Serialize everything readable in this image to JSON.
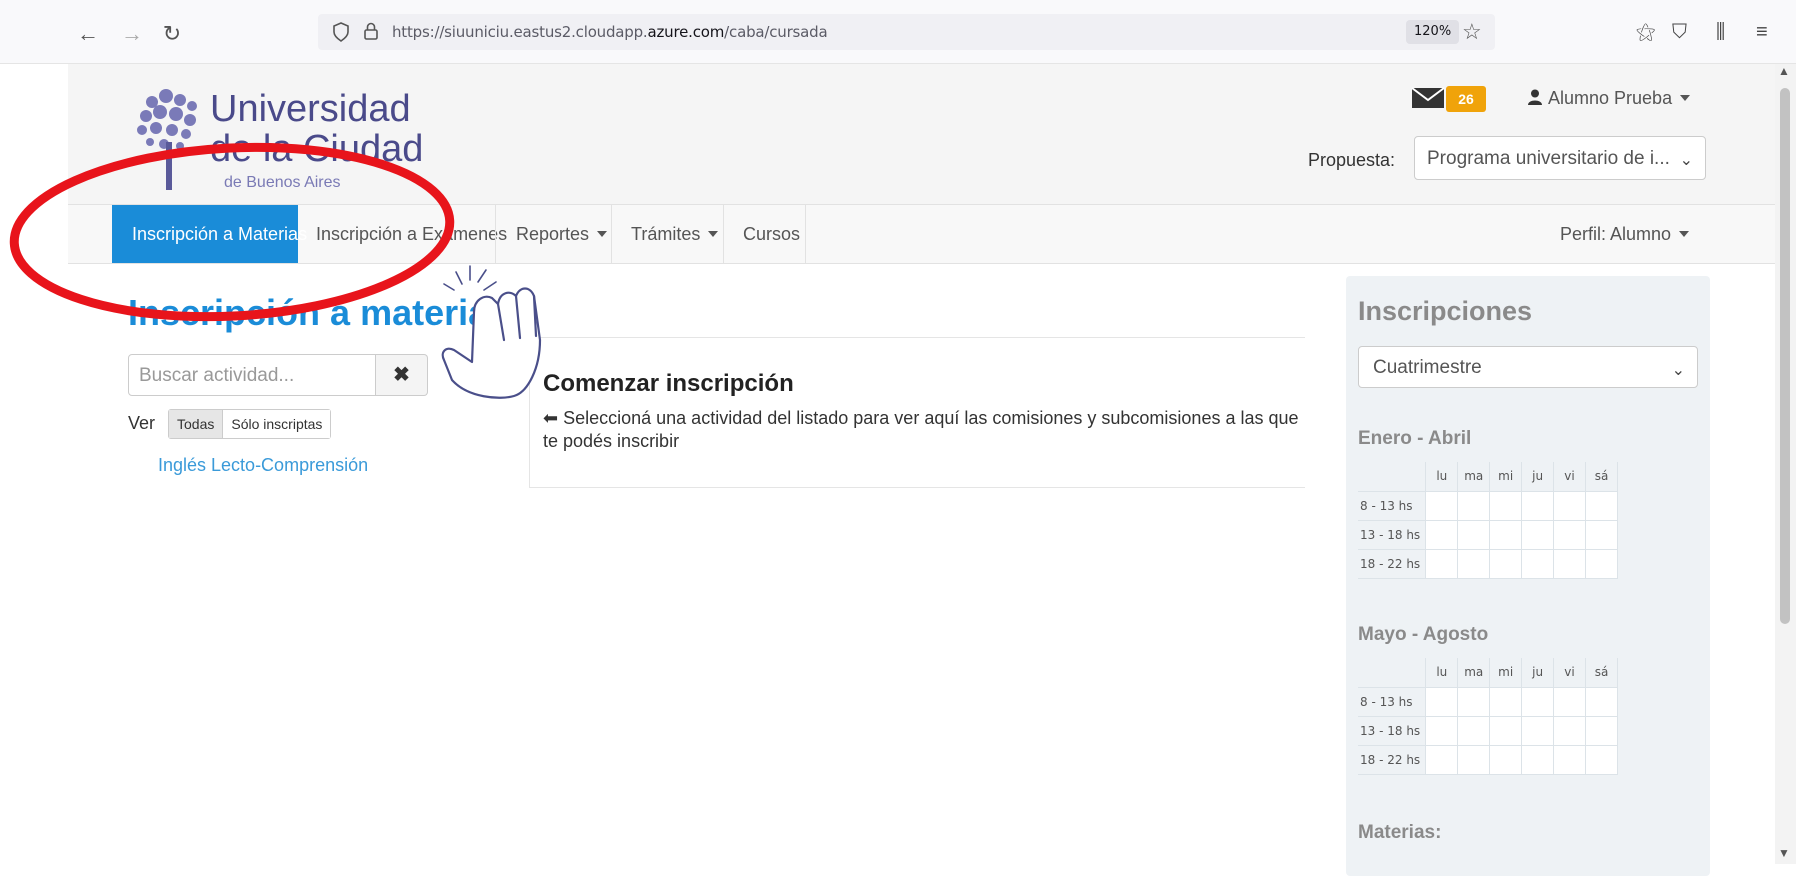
{
  "browser": {
    "url_prefix": "https://siuuniciu.eastus2.cloudapp.",
    "url_domain": "azure.com",
    "url_path": "/caba/cursada",
    "zoom": "120%"
  },
  "header": {
    "logo_line1": "Universidad",
    "logo_line2": "de la Ciudad",
    "logo_line3": "de Buenos Aires",
    "mail_count": "26",
    "user_name": "Alumno Prueba",
    "propuesta_label": "Propuesta:",
    "propuesta_value": "Programa universitario de i..."
  },
  "navbar": {
    "items": [
      {
        "label": "Inscripción a Materias"
      },
      {
        "label": "Inscripción a Exámenes"
      },
      {
        "label": "Reportes"
      },
      {
        "label": "Trámites"
      },
      {
        "label": "Cursos"
      }
    ],
    "perfil": "Perfil: Alumno"
  },
  "main": {
    "title": "Inscripción a materias",
    "search_placeholder": "Buscar actividad...",
    "clear_icon": "✖",
    "ver_label": "Ver",
    "filter_all": "Todas",
    "filter_enrolled": "Sólo inscriptas",
    "activities": [
      "Inglés Lecto-Comprensión"
    ],
    "content_title": "Comenzar inscripción",
    "content_text": "Seleccioná una actividad del listado para ver aquí las comisiones y subcomisiones a las que te podés inscribir"
  },
  "sidebar": {
    "title": "Inscripciones",
    "period_select": "Cuatrimestre",
    "periods": [
      {
        "title": "Enero - Abril"
      },
      {
        "title": "Mayo - Agosto"
      }
    ],
    "days": [
      "lu",
      "ma",
      "mi",
      "ju",
      "vi",
      "sá"
    ],
    "slots": [
      "8 - 13 hs",
      "13 - 18 hs",
      "18 - 22 hs"
    ],
    "materias_label": "Materias:"
  },
  "annotation": {
    "color": "#e8141b"
  }
}
